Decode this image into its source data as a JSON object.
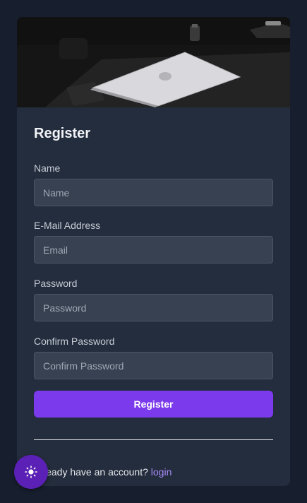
{
  "register": {
    "title": "Register",
    "fields": [
      {
        "label": "Name",
        "placeholder": "Name"
      },
      {
        "label": "E-Mail Address",
        "placeholder": "Email"
      },
      {
        "label": "Password",
        "placeholder": "Password"
      },
      {
        "label": "Confirm Password",
        "placeholder": "Confirm Password"
      }
    ],
    "submit_label": "Register"
  },
  "footer": {
    "prompt": "Already have an account? ",
    "link_label": "login"
  },
  "theme_toggle": {
    "icon": "sun-icon"
  },
  "colors": {
    "background": "#171e2e",
    "card": "#242d3d",
    "accent": "#7c3aed",
    "link": "#a78bfa"
  }
}
